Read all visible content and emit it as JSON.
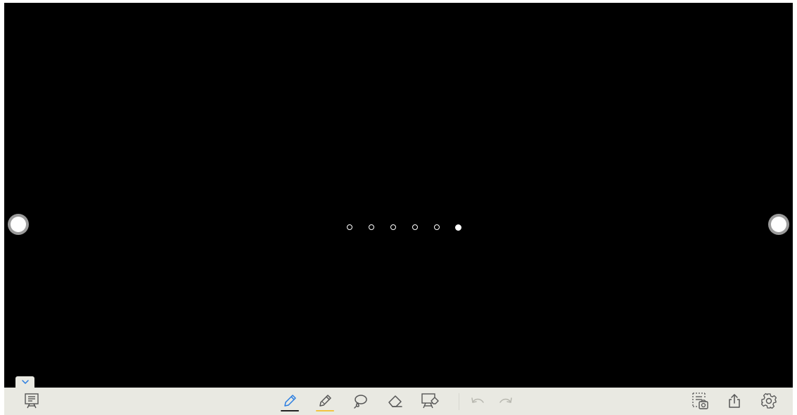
{
  "canvas": {
    "background": "#000000",
    "pages": {
      "count": 6,
      "current": 6
    }
  },
  "navigation": {
    "previous_icon": "circle-nav-left",
    "next_icon": "circle-nav-right"
  },
  "toolbar": {
    "background": "#e9e9e2",
    "icon_color": "#555555",
    "disabled_color": "#b8b8b0",
    "collapse_icon": "chevron-down-icon",
    "collapse_color": "#2a7de1",
    "presentation_icon": "presentation-board-icon",
    "tools": [
      {
        "name": "pen",
        "icon": "pen-icon",
        "active": true,
        "underline_color": "#222222",
        "color": "#2a7de1"
      },
      {
        "name": "highlighter",
        "icon": "highlighter-icon",
        "active": false,
        "underline_color": "#f2c443"
      },
      {
        "name": "lasso",
        "icon": "lasso-icon",
        "active": false
      },
      {
        "name": "eraser",
        "icon": "eraser-icon",
        "active": false
      },
      {
        "name": "clear-board",
        "icon": "clear-board-icon",
        "active": false
      }
    ],
    "history": [
      {
        "name": "undo",
        "icon": "undo-icon",
        "enabled": false
      },
      {
        "name": "redo",
        "icon": "redo-icon",
        "enabled": false
      }
    ],
    "right_tools": [
      {
        "name": "screenshot",
        "icon": "screenshot-icon"
      },
      {
        "name": "share",
        "icon": "share-icon"
      },
      {
        "name": "settings",
        "icon": "gear-icon"
      }
    ]
  }
}
